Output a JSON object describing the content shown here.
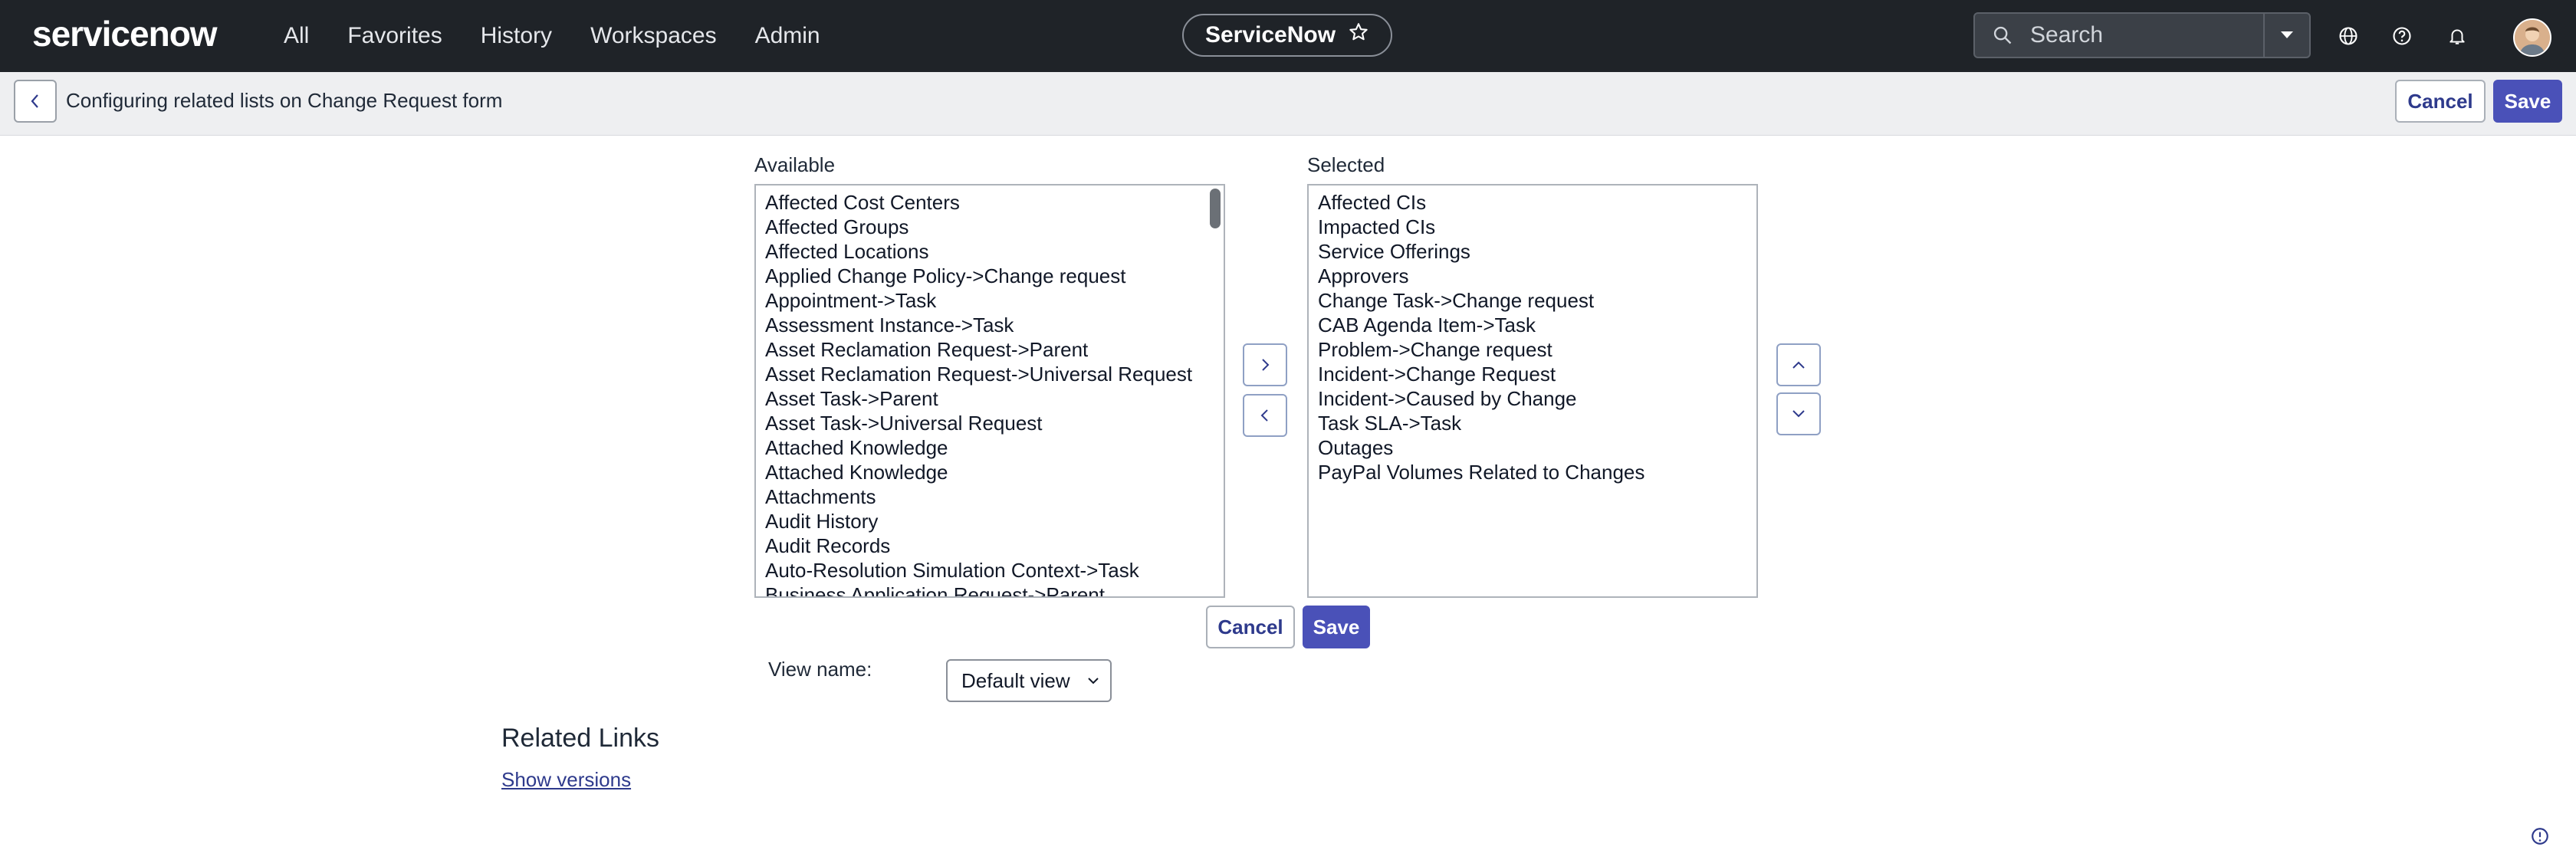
{
  "header": {
    "logo_text": "servicenow",
    "nav": [
      "All",
      "Favorites",
      "History",
      "Workspaces",
      "Admin"
    ],
    "context_pill": "ServiceNow",
    "search_placeholder": "Search"
  },
  "subheader": {
    "title": "Configuring related lists on Change Request form",
    "cancel_label": "Cancel",
    "save_label": "Save"
  },
  "slushbucket": {
    "available_label": "Available",
    "selected_label": "Selected",
    "available_items": [
      "Affected Cost Centers",
      "Affected Groups",
      "Affected Locations",
      "Applied Change Policy->Change request",
      "Appointment->Task",
      "Assessment Instance->Task",
      "Asset Reclamation Request->Parent",
      "Asset Reclamation Request->Universal Request",
      "Asset Task->Parent",
      "Asset Task->Universal Request",
      "Attached Knowledge",
      "Attached Knowledge",
      "Attachments",
      "Audit History",
      "Audit Records",
      "Auto-Resolution Simulation Context->Task",
      "Business Application Request->Parent"
    ],
    "selected_items": [
      "Affected CIs",
      "Impacted CIs",
      "Service Offerings",
      "Approvers",
      "Change Task->Change request",
      "CAB Agenda Item->Task",
      "Problem->Change request",
      "Incident->Change Request",
      "Incident->Caused by Change",
      "Task SLA->Task",
      "Outages",
      "PayPal Volumes Related to Changes"
    ],
    "cancel_label": "Cancel",
    "save_label": "Save"
  },
  "view": {
    "label": "View name:",
    "selected_value": "Default view"
  },
  "related_links": {
    "title": "Related Links",
    "link": "Show versions"
  },
  "colors": {
    "topbar": "#1f2328",
    "primary": "#4a51b8",
    "subbar": "#eeeff1"
  }
}
